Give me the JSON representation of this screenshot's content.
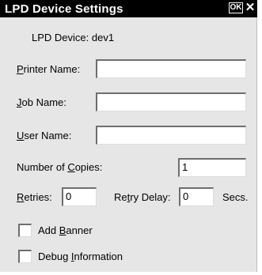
{
  "window": {
    "title": "LPD Device Settings",
    "ok_label": "OK",
    "close_label": "✕"
  },
  "device": {
    "label": "LPD Device:",
    "value": "dev1"
  },
  "printer_name": {
    "label_pre": "",
    "label_key": "P",
    "label_post": "rinter Name:",
    "value": ""
  },
  "job_name": {
    "label_pre": "",
    "label_key": "J",
    "label_post": "ob Name:",
    "value": ""
  },
  "user_name": {
    "label_pre": "",
    "label_key": "U",
    "label_post": "ser Name:",
    "value": ""
  },
  "copies": {
    "label_pre": "Number of ",
    "label_key": "C",
    "label_post": "opies:",
    "value": "1"
  },
  "retries": {
    "label_pre": "",
    "label_key": "R",
    "label_post": "etries:",
    "value": "0"
  },
  "retry_delay": {
    "label_pre": "Re",
    "label_key": "t",
    "label_post": "ry Delay:",
    "value": "0",
    "unit": "Secs."
  },
  "add_banner": {
    "label_pre": "Add ",
    "label_key": "B",
    "label_post": "anner",
    "checked": false
  },
  "debug_info": {
    "label_pre": "Debug ",
    "label_key": "I",
    "label_post": "nformation",
    "checked": false
  }
}
